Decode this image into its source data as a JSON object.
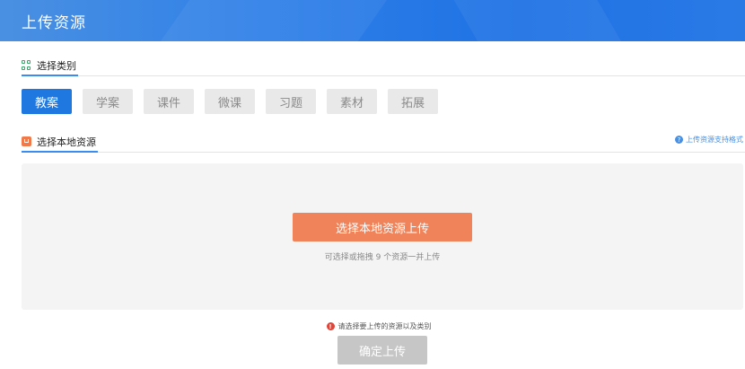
{
  "header": {
    "title": "上传资源"
  },
  "category_section": {
    "title": "选择类别",
    "icon": "grid-icon"
  },
  "categories": [
    {
      "label": "教案",
      "active": true
    },
    {
      "label": "学案",
      "active": false
    },
    {
      "label": "课件",
      "active": false
    },
    {
      "label": "微课",
      "active": false
    },
    {
      "label": "习题",
      "active": false
    },
    {
      "label": "素材",
      "active": false
    },
    {
      "label": "拓展",
      "active": false
    }
  ],
  "local_section": {
    "title": "选择本地资源",
    "icon": "local-resource-icon",
    "help_text": "上传资源支持格式"
  },
  "upload": {
    "button_label": "选择本地资源上传",
    "hint": "可选择或拖拽 9 个资源一并上传"
  },
  "footer": {
    "warning": "请选择要上传的资源以及类别",
    "confirm_label": "确定上传"
  },
  "colors": {
    "header": "#1f72e4",
    "accent": "#1f78e0",
    "upload": "#f0835a",
    "warning": "#e0453a",
    "disabled": "#c6c6c6"
  }
}
